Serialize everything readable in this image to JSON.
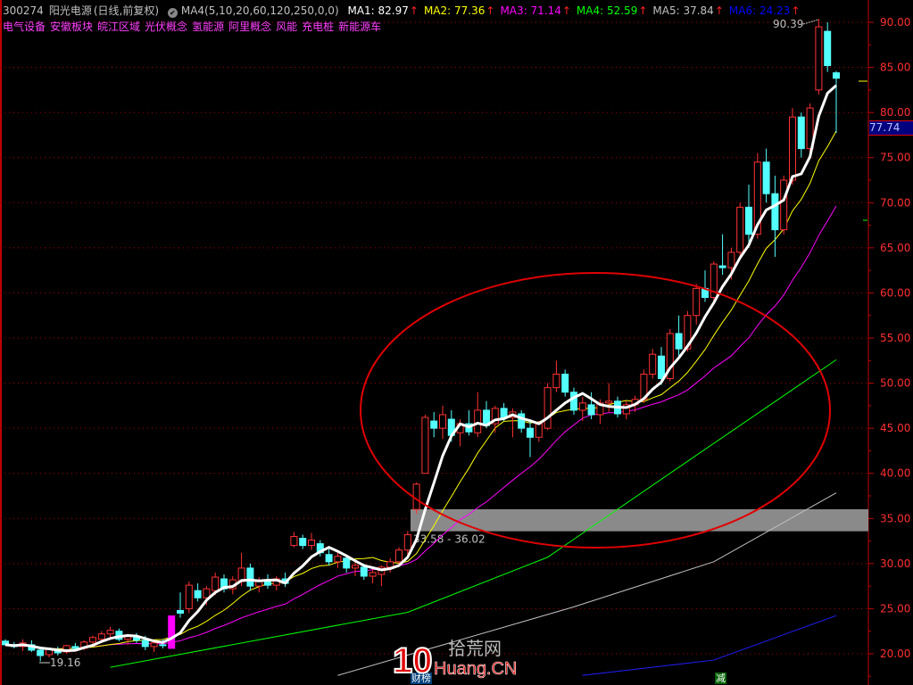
{
  "header": {
    "code": "300274",
    "name": "阳光电源",
    "period": "(日线,前复权)",
    "indicator": "MA4(5,10,20,60,120,250,0,0)",
    "ma": [
      {
        "label": "MA1: 82.97",
        "color": "#ffffff"
      },
      {
        "label": "MA2: 77.36",
        "color": "#ffff00"
      },
      {
        "label": "MA3: 71.14",
        "color": "#ff00ff"
      },
      {
        "label": "MA4: 52.59",
        "color": "#00ff00"
      },
      {
        "label": "MA5: 37.84",
        "color": "#c0c0c0"
      },
      {
        "label": "MA6: 24.23",
        "color": "#0000ff"
      }
    ],
    "up_arrow": "↑"
  },
  "tags": [
    "电气设备",
    "安徽板块",
    "皖江区域",
    "光伏概念",
    "氢能源",
    "阿里概念",
    "风能",
    "充电桩",
    "新能源车"
  ],
  "last_price": "77.74",
  "high_label": "90.39",
  "low_label": "19.16",
  "band_label": "33.58 - 36.02",
  "badges": {
    "left": "财榜",
    "right": "减"
  },
  "watermark": {
    "num": "10",
    "cn": "拾荒网",
    "en": "Huang.CN"
  },
  "colors": {
    "up": "#ff3232",
    "down": "#54ffff",
    "limit": "#ff00ff",
    "axis": "#ff3030"
  },
  "chart_data": {
    "type": "candlestick",
    "yticks": [
      "90.00",
      "85.00",
      "80.00",
      "75.00",
      "70.00",
      "65.00",
      "60.00",
      "55.00",
      "50.00",
      "45.00",
      "40.00",
      "35.00",
      "30.00",
      "25.00",
      "20.00"
    ],
    "ylim": [
      20,
      90
    ],
    "band": [
      33.58,
      36.02
    ],
    "limit_up_index": 19,
    "ohlc": [
      [
        21.4,
        21.6,
        20.9,
        21.0
      ],
      [
        21.0,
        21.3,
        20.6,
        20.8
      ],
      [
        20.8,
        21.6,
        20.3,
        21.2
      ],
      [
        21.0,
        21.5,
        20.2,
        20.4
      ],
      [
        20.4,
        20.8,
        19.16,
        19.8
      ],
      [
        19.9,
        20.6,
        19.6,
        20.5
      ],
      [
        20.3,
        20.8,
        19.8,
        20.1
      ],
      [
        20.2,
        21.0,
        20.0,
        20.9
      ],
      [
        20.8,
        21.2,
        20.3,
        20.6
      ],
      [
        20.6,
        21.5,
        20.4,
        21.3
      ],
      [
        21.3,
        22.0,
        21.0,
        21.8
      ],
      [
        21.6,
        22.5,
        21.4,
        22.2
      ],
      [
        22.2,
        23.0,
        21.8,
        22.6
      ],
      [
        22.5,
        22.8,
        21.4,
        21.6
      ],
      [
        21.6,
        22.2,
        21.0,
        21.9
      ],
      [
        21.9,
        22.3,
        21.2,
        21.5
      ],
      [
        21.5,
        22.0,
        20.4,
        20.8
      ],
      [
        20.8,
        21.4,
        20.2,
        21.2
      ],
      [
        21.0,
        21.6,
        20.6,
        20.9
      ],
      [
        20.6,
        24.2,
        20.6,
        24.2
      ],
      [
        24.8,
        26.8,
        24.0,
        24.5
      ],
      [
        25.0,
        28.0,
        24.5,
        27.6
      ],
      [
        27.0,
        27.8,
        25.8,
        26.2
      ],
      [
        26.2,
        27.5,
        25.4,
        27.2
      ],
      [
        27.0,
        29.0,
        26.5,
        28.5
      ],
      [
        28.3,
        28.8,
        26.8,
        27.2
      ],
      [
        27.2,
        28.6,
        26.6,
        28.2
      ],
      [
        28.0,
        31.2,
        27.5,
        29.5
      ],
      [
        29.5,
        30.0,
        27.0,
        27.5
      ],
      [
        27.5,
        28.5,
        26.8,
        28.0
      ],
      [
        28.0,
        28.8,
        27.2,
        27.6
      ],
      [
        27.6,
        28.6,
        27.0,
        28.3
      ],
      [
        28.3,
        29.0,
        27.4,
        27.8
      ],
      [
        32.0,
        33.5,
        31.8,
        33.0
      ],
      [
        32.8,
        33.2,
        31.6,
        32.0
      ],
      [
        32.0,
        33.4,
        31.5,
        32.6
      ],
      [
        32.2,
        32.6,
        30.8,
        31.2
      ],
      [
        31.0,
        31.6,
        29.8,
        30.2
      ],
      [
        30.2,
        31.2,
        29.5,
        30.8
      ],
      [
        30.6,
        31.0,
        29.0,
        29.5
      ],
      [
        29.5,
        30.4,
        28.6,
        29.8
      ],
      [
        29.6,
        30.0,
        28.2,
        28.6
      ],
      [
        28.6,
        29.4,
        27.8,
        29.0
      ],
      [
        28.8,
        29.8,
        27.5,
        29.6
      ],
      [
        29.6,
        30.6,
        29.0,
        30.2
      ],
      [
        30.2,
        31.8,
        29.8,
        31.5
      ],
      [
        31.5,
        33.6,
        31.0,
        33.2
      ],
      [
        36.0,
        39.0,
        35.5,
        38.8
      ],
      [
        40.0,
        46.5,
        40.0,
        46.2
      ],
      [
        45.8,
        46.8,
        44.0,
        45.0
      ],
      [
        45.0,
        47.5,
        43.8,
        46.5
      ],
      [
        46.0,
        47.0,
        43.5,
        44.2
      ],
      [
        44.5,
        46.0,
        43.0,
        45.5
      ],
      [
        45.5,
        47.0,
        44.2,
        44.6
      ],
      [
        44.5,
        49.0,
        44.0,
        47.0
      ],
      [
        47.0,
        48.0,
        45.0,
        45.3
      ],
      [
        45.5,
        47.5,
        44.5,
        47.2
      ],
      [
        47.2,
        47.8,
        45.8,
        46.2
      ],
      [
        46.2,
        47.2,
        44.0,
        46.8
      ],
      [
        46.6,
        47.0,
        44.5,
        45.0
      ],
      [
        45.0,
        46.0,
        41.8,
        44.0
      ],
      [
        44.0,
        45.8,
        43.5,
        45.5
      ],
      [
        45.0,
        50.0,
        44.8,
        49.5
      ],
      [
        49.5,
        52.5,
        49.0,
        51.0
      ],
      [
        51.0,
        51.5,
        48.5,
        49.0
      ],
      [
        49.0,
        49.5,
        46.5,
        47.0
      ],
      [
        47.0,
        48.5,
        45.8,
        47.8
      ],
      [
        47.6,
        49.0,
        46.0,
        46.5
      ],
      [
        46.5,
        48.2,
        45.5,
        47.8
      ],
      [
        47.8,
        50.0,
        46.8,
        48.0
      ],
      [
        48.0,
        48.5,
        46.2,
        46.6
      ],
      [
        46.6,
        48.0,
        46.0,
        47.6
      ],
      [
        47.6,
        48.6,
        46.8,
        48.2
      ],
      [
        48.2,
        51.5,
        47.8,
        51.0
      ],
      [
        51.0,
        53.8,
        50.5,
        53.2
      ],
      [
        53.0,
        54.0,
        49.8,
        50.5
      ],
      [
        50.5,
        56.0,
        50.2,
        55.5
      ],
      [
        55.5,
        57.5,
        53.0,
        53.8
      ],
      [
        53.8,
        58.0,
        53.5,
        57.5
      ],
      [
        57.5,
        61.0,
        56.5,
        60.5
      ],
      [
        60.5,
        62.5,
        59.0,
        59.5
      ],
      [
        59.5,
        63.5,
        59.0,
        63.2
      ],
      [
        63.0,
        66.5,
        62.0,
        62.8
      ],
      [
        62.8,
        65.0,
        61.5,
        64.5
      ],
      [
        64.5,
        70.0,
        64.0,
        69.5
      ],
      [
        69.5,
        72.0,
        65.0,
        66.5
      ],
      [
        66.5,
        75.5,
        66.0,
        74.5
      ],
      [
        74.5,
        76.0,
        70.0,
        71.0
      ],
      [
        71.0,
        73.0,
        64.0,
        67.0
      ],
      [
        67.0,
        73.0,
        66.5,
        72.5
      ],
      [
        72.5,
        80.5,
        72.0,
        79.5
      ],
      [
        79.5,
        80.0,
        75.0,
        76.0
      ],
      [
        76.0,
        81.0,
        75.5,
        80.5
      ],
      [
        82.5,
        90.39,
        82.0,
        89.5
      ],
      [
        89.0,
        90.0,
        84.5,
        85.2
      ],
      [
        84.4,
        84.6,
        77.74,
        83.8
      ]
    ],
    "ma_long": [
      {
        "period": 60,
        "color": "#00ff00",
        "points": [
          [
            12,
            18.5
          ],
          [
            46,
            24.6
          ],
          [
            62,
            30.7
          ],
          [
            79,
            42.0
          ],
          [
            95,
            52.59
          ]
        ]
      },
      {
        "period": 120,
        "color": "#c0c0c0",
        "points": [
          [
            38,
            17.6
          ],
          [
            65,
            25.2
          ],
          [
            81,
            30.2
          ],
          [
            95,
            37.84
          ]
        ]
      },
      {
        "period": 250,
        "color": "#2020ff",
        "points": [
          [
            66,
            17.6
          ],
          [
            81,
            19.3
          ],
          [
            95,
            24.23
          ]
        ]
      }
    ]
  }
}
